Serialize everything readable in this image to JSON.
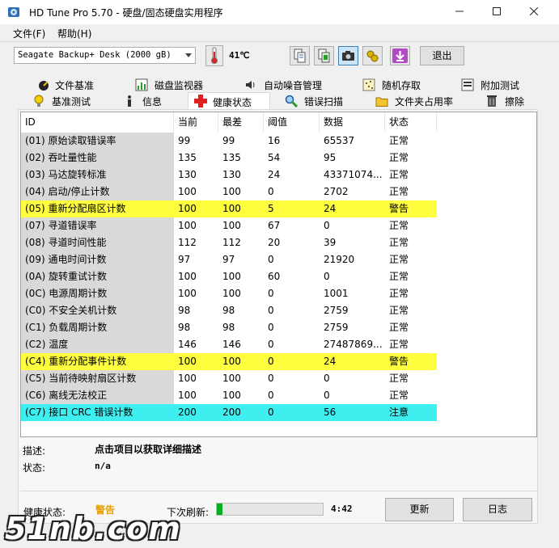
{
  "window": {
    "title": "HD Tune Pro 5.70 - 硬盘/固态硬盘实用程序"
  },
  "menu": [
    "文件(F)",
    "帮助(H)"
  ],
  "toolbar": {
    "drive": "Seagate Backup+  Desk (2000 gB)",
    "temperature": "41℃",
    "exit_label": "退出",
    "icons": [
      "copy-info-icon",
      "copy-screen-icon",
      "camera-icon",
      "settings-icon",
      "download-icon"
    ]
  },
  "tabs_top": [
    "文件基准",
    "磁盘监视器",
    "自动噪音管理",
    "随机存取",
    "附加测试"
  ],
  "tabs_bottom": [
    "基准测试",
    "信息",
    "健康状态",
    "错误扫描",
    "文件夹占用率",
    "擦除"
  ],
  "selected_tab": "健康状态",
  "table": {
    "columns": [
      "ID",
      "当前",
      "最差",
      "阈值",
      "数据",
      "状态"
    ],
    "rows": [
      {
        "id": "(01) 原始读取错误率",
        "cur": "99",
        "worst": "99",
        "thr": "16",
        "data": "65537",
        "status": "正常",
        "level": "ok"
      },
      {
        "id": "(02) 吞吐量性能",
        "cur": "135",
        "worst": "135",
        "thr": "54",
        "data": "95",
        "status": "正常",
        "level": "ok"
      },
      {
        "id": "(03) 马达旋转标准",
        "cur": "130",
        "worst": "130",
        "thr": "24",
        "data": "43371074...",
        "status": "正常",
        "level": "ok"
      },
      {
        "id": "(04) 启动/停止计数",
        "cur": "100",
        "worst": "100",
        "thr": "0",
        "data": "2702",
        "status": "正常",
        "level": "ok"
      },
      {
        "id": "(05) 重新分配扇区计数",
        "cur": "100",
        "worst": "100",
        "thr": "5",
        "data": "24",
        "status": "警告",
        "level": "warn"
      },
      {
        "id": "(07) 寻道错误率",
        "cur": "100",
        "worst": "100",
        "thr": "67",
        "data": "0",
        "status": "正常",
        "level": "ok"
      },
      {
        "id": "(08) 寻道时间性能",
        "cur": "112",
        "worst": "112",
        "thr": "20",
        "data": "39",
        "status": "正常",
        "level": "ok"
      },
      {
        "id": "(09) 通电时间计数",
        "cur": "97",
        "worst": "97",
        "thr": "0",
        "data": "21920",
        "status": "正常",
        "level": "ok"
      },
      {
        "id": "(0A) 旋转重试计数",
        "cur": "100",
        "worst": "100",
        "thr": "60",
        "data": "0",
        "status": "正常",
        "level": "ok"
      },
      {
        "id": "(0C) 电源周期计数",
        "cur": "100",
        "worst": "100",
        "thr": "0",
        "data": "1001",
        "status": "正常",
        "level": "ok"
      },
      {
        "id": "(C0) 不安全关机计数",
        "cur": "98",
        "worst": "98",
        "thr": "0",
        "data": "2759",
        "status": "正常",
        "level": "ok"
      },
      {
        "id": "(C1) 负载周期计数",
        "cur": "98",
        "worst": "98",
        "thr": "0",
        "data": "2759",
        "status": "正常",
        "level": "ok"
      },
      {
        "id": "(C2) 温度",
        "cur": "146",
        "worst": "146",
        "thr": "0",
        "data": "27487869...",
        "status": "正常",
        "level": "ok"
      },
      {
        "id": "(C4) 重新分配事件计数",
        "cur": "100",
        "worst": "100",
        "thr": "0",
        "data": "24",
        "status": "警告",
        "level": "warn"
      },
      {
        "id": "(C5) 当前待映射扇区计数",
        "cur": "100",
        "worst": "100",
        "thr": "0",
        "data": "0",
        "status": "正常",
        "level": "ok"
      },
      {
        "id": "(C6) 离线无法校正",
        "cur": "100",
        "worst": "100",
        "thr": "0",
        "data": "0",
        "status": "正常",
        "level": "ok"
      },
      {
        "id": "(C7) 接口 CRC 错误计数",
        "cur": "200",
        "worst": "200",
        "thr": "0",
        "data": "56",
        "status": "注意",
        "level": "note"
      }
    ]
  },
  "details": {
    "desc_label": "描述:",
    "desc_value": "点击项目以获取详细描述",
    "state_label": "状态:",
    "state_value": "n/a"
  },
  "footer": {
    "health_label": "健康状态:",
    "health_value": "警告",
    "next_refresh_label": "下次刷新:",
    "countdown": "4:42",
    "progress_fraction": 0.05,
    "refresh_button": "更新",
    "log_button": "日志"
  },
  "watermark": "51nb.com",
  "colors": {
    "warn": "#ffff40",
    "note": "#3fefef",
    "health_warn": "#e8a000",
    "progress": "#06b025"
  }
}
